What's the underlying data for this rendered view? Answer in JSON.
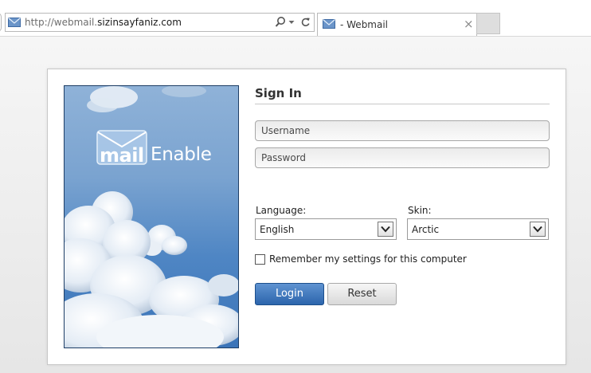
{
  "browser": {
    "address": {
      "url_prefix": "http://webmail.",
      "url_domain": "sizinsayfaniz.com"
    },
    "tab": {
      "title": "- Webmail",
      "close_glyph": "×"
    },
    "icons": {
      "favicon": "envelope-icon",
      "search": "search-icon",
      "dropdown": "chevron-down-icon",
      "refresh": "refresh-icon"
    }
  },
  "branding": {
    "logo_mail": "mail",
    "logo_enable": "Enable"
  },
  "form": {
    "title": "Sign In",
    "username_placeholder": "Username",
    "password_placeholder": "Password",
    "language_label": "Language:",
    "language_value": "English",
    "skin_label": "Skin:",
    "skin_value": "Arctic",
    "remember_label": "Remember my settings for this computer",
    "remember_checked": false,
    "login_label": "Login",
    "reset_label": "Reset"
  },
  "colors": {
    "login_button": "#2f6aae",
    "sky": "#4f86c4"
  }
}
